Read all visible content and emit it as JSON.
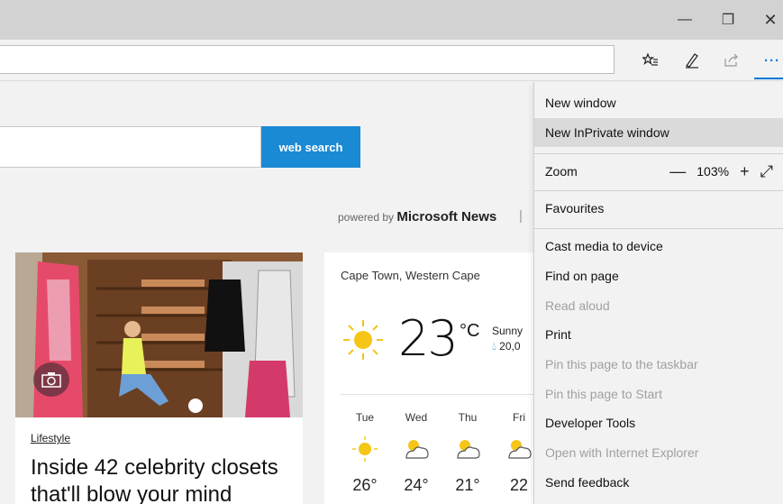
{
  "window": {
    "minimize_glyph": "—",
    "maximize_glyph": "❐",
    "close_glyph": "✕"
  },
  "toolbar": {
    "favorites_icon": "star-list-icon",
    "notes_icon": "pen-icon",
    "share_icon": "share-icon",
    "more_label": "···"
  },
  "page": {
    "search_button": "web search",
    "powered_prefix": "powered by",
    "powered_brand": "Microsoft News",
    "article": {
      "tag": "Lifestyle",
      "title": "Inside 42 celebrity closets that'll blow your mind"
    },
    "weather": {
      "location": "Cape Town, Western Cape",
      "temperature": "23",
      "unit": "°C",
      "condition": "Sunny",
      "precip": "20,0",
      "forecast": [
        {
          "day": "Tue",
          "temp": "26°",
          "icon": "sunny"
        },
        {
          "day": "Wed",
          "temp": "24°",
          "icon": "partly-cloudy"
        },
        {
          "day": "Thu",
          "temp": "21°",
          "icon": "partly-cloudy"
        },
        {
          "day": "Fri",
          "temp": "22",
          "icon": "partly-cloudy"
        }
      ]
    }
  },
  "menu": {
    "new_window": "New window",
    "new_inprivate": "New InPrivate window",
    "zoom_label": "Zoom",
    "zoom_minus": "—",
    "zoom_value": "103%",
    "zoom_plus": "+",
    "zoom_fullscreen": "⤢",
    "favourites": "Favourites",
    "cast": "Cast media to device",
    "find": "Find on page",
    "read_aloud": "Read aloud",
    "print": "Print",
    "pin_taskbar": "Pin this page to the taskbar",
    "pin_start": "Pin this page to Start",
    "devtools": "Developer Tools",
    "open_ie": "Open with Internet Explorer",
    "feedback": "Send feedback"
  },
  "colors": {
    "accent": "#0078d7",
    "search_button": "#1a8ad4",
    "sun": "#f5c518"
  }
}
